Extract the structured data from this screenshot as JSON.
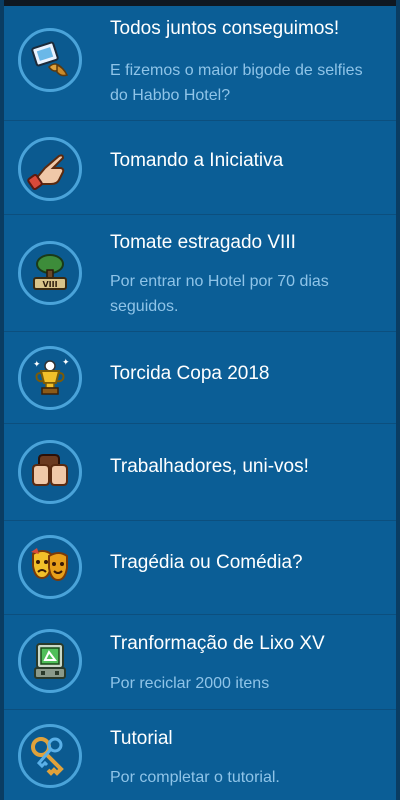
{
  "achievements": [
    {
      "title": "Todos juntos conseguimos!",
      "description": "E fizemos o maior bigode de selfies do Habbo Hotel?",
      "icon": "selfie-mustache-icon"
    },
    {
      "title": "Tomando a Iniciativa",
      "description": "",
      "icon": "pointing-hand-icon"
    },
    {
      "title": "Tomate estragado VIII",
      "description": "Por entrar no Hotel por 70 dias seguidos.",
      "icon": "tree-viii-icon"
    },
    {
      "title": "Torcida Copa 2018",
      "description": "",
      "icon": "trophy-icon"
    },
    {
      "title": "Trabalhadores, uni-vos!",
      "description": "",
      "icon": "raised-fists-icon"
    },
    {
      "title": "Tragédia ou Comédia?",
      "description": "",
      "icon": "theater-masks-icon"
    },
    {
      "title": "Tranformação de Lixo XV",
      "description": "Por reciclar 2000 itens",
      "icon": "recycle-machine-icon"
    },
    {
      "title": "Tutorial",
      "description": "Por completar o tutorial.",
      "icon": "keys-icon"
    }
  ]
}
